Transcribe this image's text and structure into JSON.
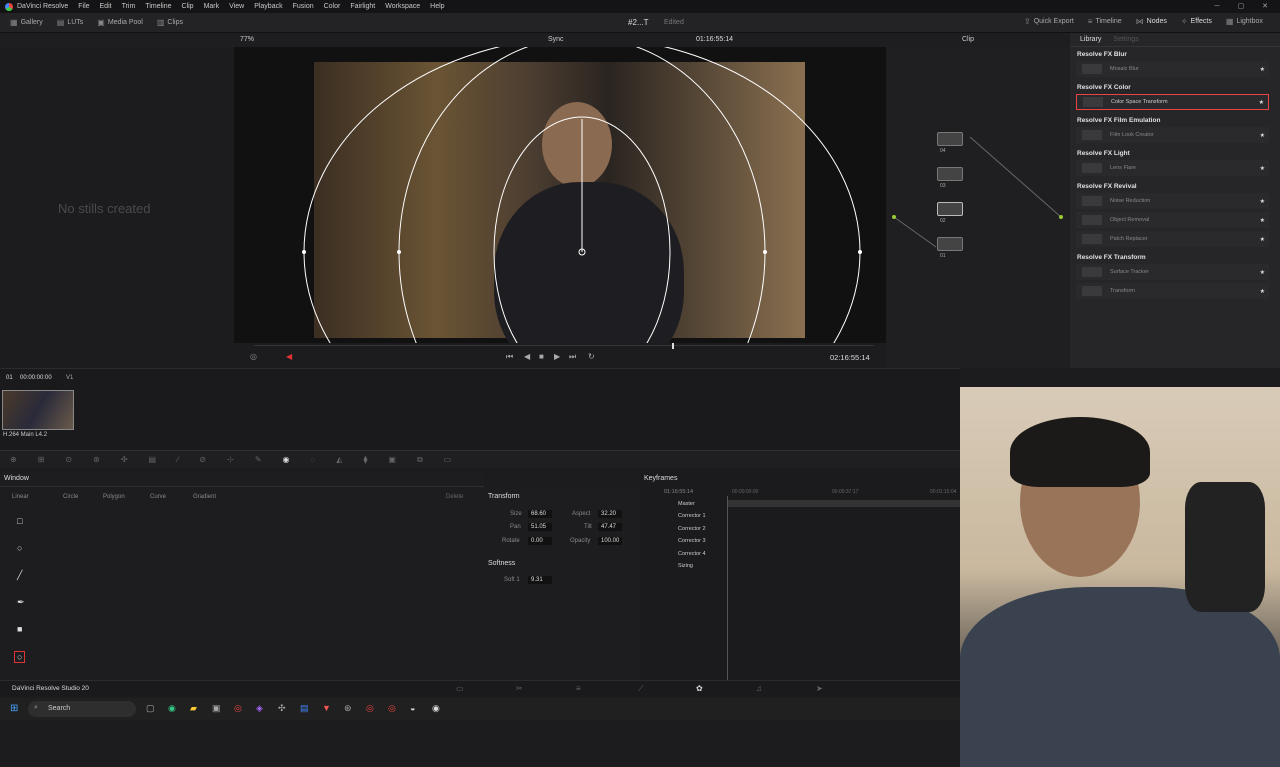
{
  "menubar": {
    "app": "DaVinci Resolve",
    "items": [
      "File",
      "Edit",
      "Trim",
      "Timeline",
      "Clip",
      "Mark",
      "View",
      "Playback",
      "Fusion",
      "Color",
      "Fairlight",
      "Workspace",
      "Help"
    ]
  },
  "toolbar": {
    "left": [
      "Gallery",
      "LUTs",
      "Media Pool",
      "Clips"
    ],
    "project": "#2...T",
    "status": "Edited",
    "right": [
      "Quick Export",
      "Timeline",
      "Nodes",
      "Effects",
      "Lightbox"
    ]
  },
  "viewer": {
    "zoom": "77%",
    "sync": "Sync",
    "timecode": "01:16:55:14",
    "clip_label": "Clip",
    "no_stills": "No stills created",
    "play_timecode": "02:16:55:14"
  },
  "library": {
    "tabs": [
      "Library",
      "Settings"
    ],
    "categories": [
      {
        "name": "Resolve FX Blur",
        "items": [
          "Mosaic Blur"
        ]
      },
      {
        "name": "Resolve FX Color",
        "items": [
          "Color Space Transform"
        ]
      },
      {
        "name": "Resolve FX Film Emulation",
        "items": [
          "Film Look Creator"
        ]
      },
      {
        "name": "Resolve FX Light",
        "items": [
          "Lens Flare"
        ]
      },
      {
        "name": "Resolve FX Revival",
        "items": [
          "Noise Reduction",
          "Object Removal",
          "Patch Replacer"
        ]
      },
      {
        "name": "Resolve FX Transform",
        "items": [
          "Surface Tracker",
          "Transform"
        ]
      }
    ]
  },
  "nodes": [
    {
      "label": "04"
    },
    {
      "label": "03"
    },
    {
      "label": "02"
    },
    {
      "label": "01"
    }
  ],
  "clip": {
    "index": "01",
    "timecode": "00:00:00:00",
    "track": "V1",
    "codec": "H.264 Main L4.2"
  },
  "window": {
    "title": "Window",
    "shapes": [
      "Linear",
      "Circle",
      "Polygon",
      "Curve",
      "Gradient"
    ],
    "delete": "Delete"
  },
  "transform": {
    "title": "Transform",
    "size": "68.60",
    "aspect": "32.20",
    "pan": "51.05",
    "tilt": "47.47",
    "rotate": "0.00",
    "opacity": "100.00",
    "labels": {
      "size": "Size",
      "aspect": "Aspect",
      "pan": "Pan",
      "tilt": "Tilt",
      "rotate": "Rotate",
      "opacity": "Opacity"
    },
    "softness_title": "Softness",
    "soft1_label": "Soft 1",
    "soft1": "9.31"
  },
  "keyframes": {
    "title": "Keyframes",
    "tc": "01:16:55:14",
    "tc2": "00:00:00:00",
    "tc3": "00:00:37:17",
    "tc4": "00:01:15:04",
    "rows": [
      "Master",
      "Corrector 1",
      "Corrector 2",
      "Corrector 3",
      "Corrector 4",
      "Sizing"
    ]
  },
  "studio": "DaVinci Resolve Studio 20",
  "taskbar": {
    "search": "Search"
  }
}
